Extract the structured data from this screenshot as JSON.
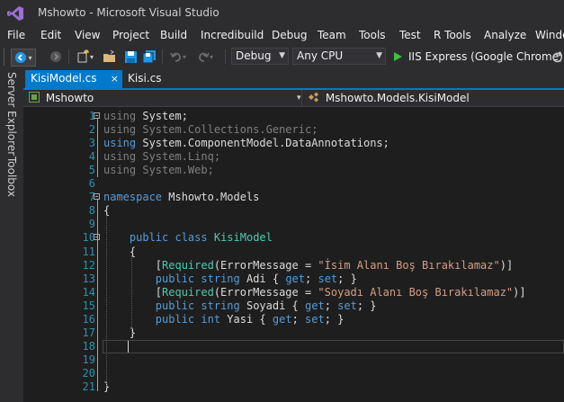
{
  "window": {
    "title": "Mshowto - Microsoft Visual Studio"
  },
  "menu": [
    "File",
    "Edit",
    "View",
    "Project",
    "Build",
    "Incredibuild",
    "Debug",
    "Team",
    "Tools",
    "Test",
    "R Tools",
    "Analyze",
    "Windo"
  ],
  "toolbar": {
    "config": "Debug",
    "platform": "Any CPU",
    "run_label": "IIS Express (Google Chrome)"
  },
  "sidebar": {
    "server_explorer": "Server Explorer",
    "toolbox": "Toolbox"
  },
  "tabs": [
    {
      "label": "KisiModel.cs",
      "active": true,
      "close": "×"
    },
    {
      "label": "Kisi.cs",
      "active": false
    }
  ],
  "navbar": {
    "project": "Mshowto",
    "type": "Mshowto.Models.KisiModel"
  },
  "editor": {
    "line_numbers": [
      "1",
      "2",
      "3",
      "4",
      "5",
      "6",
      "7",
      "8",
      "9",
      "10",
      "11",
      "12",
      "13",
      "14",
      "15",
      "16",
      "17",
      "18",
      "19",
      "20",
      "21"
    ],
    "lines": [
      [
        {
          "t": "using",
          "c": "dim"
        },
        {
          "t": " System;",
          "c": "pl"
        }
      ],
      [
        {
          "t": "using",
          "c": "dim"
        },
        {
          "t": " System.Collections.Generic;",
          "c": "dim"
        }
      ],
      [
        {
          "t": "using",
          "c": "kw"
        },
        {
          "t": " System.ComponentModel.DataAnnotations;",
          "c": "pl"
        }
      ],
      [
        {
          "t": "using",
          "c": "dim"
        },
        {
          "t": " System.Linq;",
          "c": "dim"
        }
      ],
      [
        {
          "t": "using",
          "c": "dim"
        },
        {
          "t": " System.Web;",
          "c": "dim"
        }
      ],
      [],
      [
        {
          "t": "namespace",
          "c": "kw"
        },
        {
          "t": " Mshowto.Models",
          "c": "pl"
        }
      ],
      [
        {
          "t": "{",
          "c": "pl"
        }
      ],
      [],
      [
        {
          "t": "    public",
          "c": "kw"
        },
        {
          "t": " ",
          "c": "pl"
        },
        {
          "t": "class",
          "c": "kw"
        },
        {
          "t": " ",
          "c": "pl"
        },
        {
          "t": "KisiModel",
          "c": "ty"
        }
      ],
      [
        {
          "t": "    {",
          "c": "pl"
        }
      ],
      [
        {
          "t": "        [",
          "c": "pl"
        },
        {
          "t": "Required",
          "c": "ty"
        },
        {
          "t": "(ErrorMessage = ",
          "c": "pl"
        },
        {
          "t": "\"İsim Alanı Boş Bırakılamaz\"",
          "c": "st"
        },
        {
          "t": ")]",
          "c": "pl"
        }
      ],
      [
        {
          "t": "        public",
          "c": "kw"
        },
        {
          "t": " ",
          "c": "pl"
        },
        {
          "t": "string",
          "c": "kw"
        },
        {
          "t": " Adi { ",
          "c": "pl"
        },
        {
          "t": "get",
          "c": "kw"
        },
        {
          "t": "; ",
          "c": "pl"
        },
        {
          "t": "set",
          "c": "kw"
        },
        {
          "t": "; }",
          "c": "pl"
        }
      ],
      [
        {
          "t": "        [",
          "c": "pl"
        },
        {
          "t": "Required",
          "c": "ty"
        },
        {
          "t": "(ErrorMessage = ",
          "c": "pl"
        },
        {
          "t": "\"Soyadı Alanı Boş Bırakılamaz\"",
          "c": "st"
        },
        {
          "t": ")]",
          "c": "pl"
        }
      ],
      [
        {
          "t": "        public",
          "c": "kw"
        },
        {
          "t": " ",
          "c": "pl"
        },
        {
          "t": "string",
          "c": "kw"
        },
        {
          "t": " Soyadi { ",
          "c": "pl"
        },
        {
          "t": "get",
          "c": "kw"
        },
        {
          "t": "; ",
          "c": "pl"
        },
        {
          "t": "set",
          "c": "kw"
        },
        {
          "t": "; }",
          "c": "pl"
        }
      ],
      [
        {
          "t": "        public",
          "c": "kw"
        },
        {
          "t": " ",
          "c": "pl"
        },
        {
          "t": "int",
          "c": "kw"
        },
        {
          "t": " Yasi { ",
          "c": "pl"
        },
        {
          "t": "get",
          "c": "kw"
        },
        {
          "t": "; ",
          "c": "pl"
        },
        {
          "t": "set",
          "c": "kw"
        },
        {
          "t": "; }",
          "c": "pl"
        }
      ],
      [
        {
          "t": "    }",
          "c": "pl"
        }
      ],
      [],
      [],
      [],
      [
        {
          "t": "}",
          "c": "pl"
        }
      ]
    ]
  }
}
